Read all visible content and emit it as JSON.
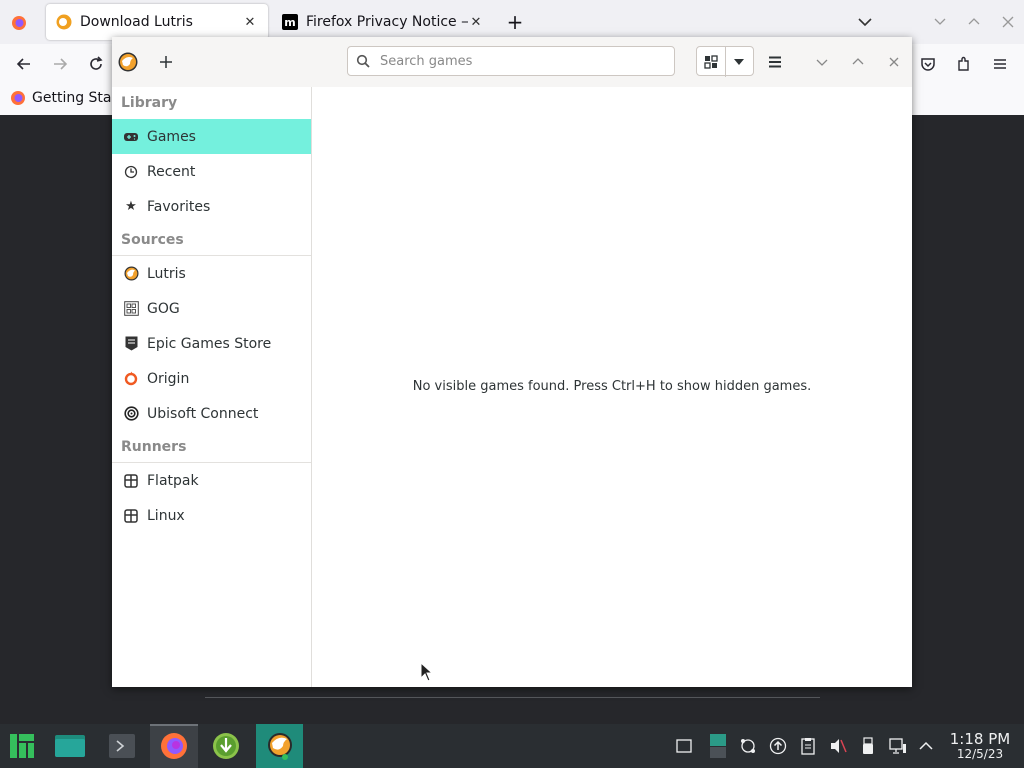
{
  "firefox": {
    "tabs": [
      {
        "label": "Download Lutris",
        "active": true
      },
      {
        "label": "Firefox Privacy Notice — M",
        "active": false
      }
    ],
    "new_tab_symbol": "+",
    "bookmark": "Getting Start"
  },
  "lutris": {
    "search_placeholder": "Search games",
    "sidebar": {
      "library_title": "Library",
      "library": [
        {
          "label": "Games",
          "icon": "gamepad-icon",
          "active": true
        },
        {
          "label": "Recent",
          "icon": "clock-icon"
        },
        {
          "label": "Favorites",
          "icon": "star-icon"
        }
      ],
      "sources_title": "Sources",
      "sources": [
        {
          "label": "Lutris",
          "icon": "lutris-icon"
        },
        {
          "label": "GOG",
          "icon": "gog-icon"
        },
        {
          "label": "Epic Games Store",
          "icon": "epic-icon"
        },
        {
          "label": "Origin",
          "icon": "origin-icon"
        },
        {
          "label": "Ubisoft Connect",
          "icon": "ubisoft-icon"
        }
      ],
      "runners_title": "Runners",
      "runners": [
        {
          "label": "Flatpak",
          "icon": "runner-icon"
        },
        {
          "label": "Linux",
          "icon": "runner-icon"
        }
      ]
    },
    "empty_message": "No visible games found. Press Ctrl+H to show hidden games."
  },
  "taskbar": {
    "time": "1:18 PM",
    "date": "12/5/23"
  },
  "colors": {
    "active_item": "#74f0dd",
    "taskbar": "#2a2e32",
    "manjaro_green": "#35bf5c"
  }
}
